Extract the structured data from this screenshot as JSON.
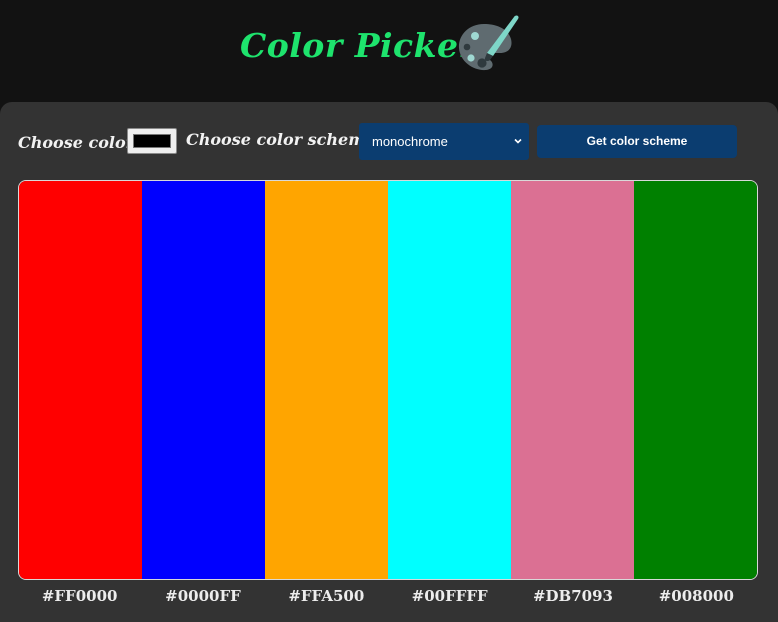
{
  "header": {
    "title": "Color Picker",
    "icon": "palette-brush-icon"
  },
  "controls": {
    "choose_color_label": "Choose color",
    "color_value": "#000000",
    "choose_scheme_label": "Choose color scheme",
    "scheme_selected": "monochrome",
    "button_label": "Get color scheme"
  },
  "theme": {
    "page_bg": "#121212",
    "panel_bg": "#333333",
    "accent": "#1ee36d",
    "control_bg": "#0b3d70"
  },
  "scheme": [
    {
      "color": "#FF0000",
      "label": "#FF0000"
    },
    {
      "color": "#0000FF",
      "label": "#0000FF"
    },
    {
      "color": "#FFA500",
      "label": "#FFA500"
    },
    {
      "color": "#00FFFF",
      "label": "#00FFFF"
    },
    {
      "color": "#DB7093",
      "label": "#DB7093"
    },
    {
      "color": "#008000",
      "label": "#008000"
    }
  ]
}
